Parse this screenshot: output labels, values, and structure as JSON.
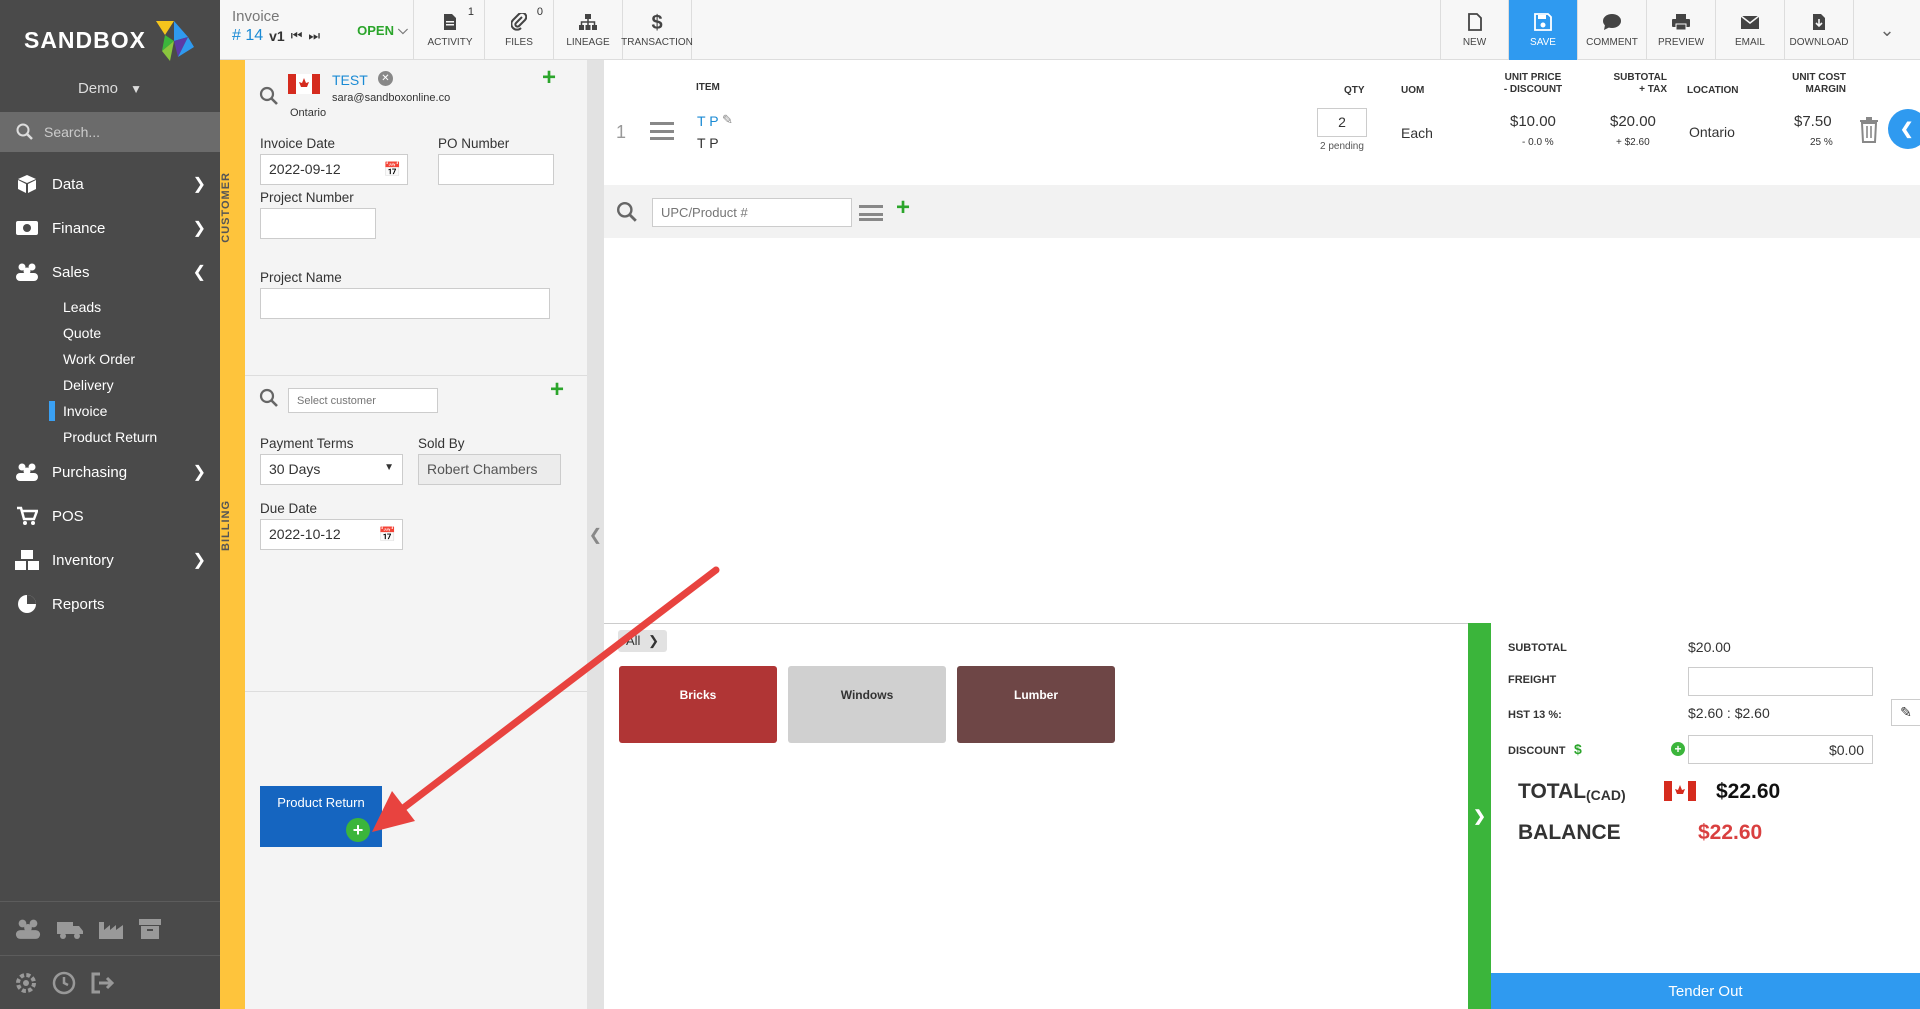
{
  "app": {
    "logo_text": "SANDBOX",
    "company": "Demo"
  },
  "sidebar": {
    "search_placeholder": "Search...",
    "items": [
      {
        "label": "Data",
        "icon": "cube-icon"
      },
      {
        "label": "Finance",
        "icon": "money-icon"
      },
      {
        "label": "Sales",
        "icon": "people-icon"
      },
      {
        "label": "Purchasing",
        "icon": "people-icon"
      },
      {
        "label": "POS",
        "icon": "cart-icon"
      },
      {
        "label": "Inventory",
        "icon": "boxes-icon"
      },
      {
        "label": "Reports",
        "icon": "pie-icon"
      }
    ],
    "sales_sub": [
      "Leads",
      "Quote",
      "Work Order",
      "Delivery",
      "Invoice",
      "Product Return"
    ]
  },
  "topbar": {
    "doc_type": "Invoice",
    "doc_number": "# 14",
    "version": "v1",
    "status": "OPEN",
    "buttons": {
      "activity": "ACTIVITY",
      "activity_count": "1",
      "files": "FILES",
      "files_count": "0",
      "lineage": "LINEAGE",
      "transaction": "TRANSACTION",
      "new": "NEW",
      "save": "SAVE",
      "comment": "COMMENT",
      "preview": "PREVIEW",
      "email": "EMAIL",
      "download": "DOWNLOAD"
    }
  },
  "customer": {
    "section_label": "CUSTOMER",
    "name": "TEST",
    "email": "sara@sandboxonline.co",
    "region": "Ontario",
    "invoice_date_label": "Invoice Date",
    "invoice_date": "2022-09-12",
    "po_label": "PO Number",
    "po_value": "",
    "project_number_label": "Project Number",
    "project_number": "",
    "project_name_label": "Project Name",
    "project_name": ""
  },
  "billing": {
    "section_label": "BILLING",
    "select_placeholder": "Select customer",
    "payment_terms_label": "Payment Terms",
    "payment_terms": "30 Days",
    "sold_by_label": "Sold By",
    "sold_by": "Robert Chambers",
    "due_date_label": "Due Date",
    "due_date": "2022-10-12"
  },
  "product_return_button": "Product Return",
  "line_headers": {
    "item": "ITEM",
    "qty": "QTY",
    "uom": "UOM",
    "unit_price": "UNIT PRICE",
    "unit_price_sub": "- DISCOUNT",
    "subtotal": "SUBTOTAL",
    "subtotal_sub": "+ TAX",
    "location": "LOCATION",
    "unit_cost": "UNIT COST",
    "unit_cost_sub": "MARGIN"
  },
  "line_items": [
    {
      "index": "1",
      "code": "T P",
      "description": "T P",
      "qty": "2",
      "pending": "2 pending",
      "uom": "Each",
      "unit_price": "$10.00",
      "discount": "- 0.0 %",
      "subtotal": "$20.00",
      "tax": "+ $2.60",
      "location": "Ontario",
      "unit_cost": "$7.50",
      "margin": "25 %"
    }
  ],
  "add_product": {
    "placeholder": "UPC/Product #"
  },
  "categories": {
    "breadcrumb": "All",
    "tiles": [
      {
        "label": "Bricks",
        "color": "#b03535"
      },
      {
        "label": "Windows",
        "color": "#d0d0d0"
      },
      {
        "label": "Lumber",
        "color": "#6e4646"
      }
    ]
  },
  "totals": {
    "subtotal_label": "SUBTOTAL",
    "subtotal": "$20.00",
    "freight_label": "FREIGHT",
    "freight": "",
    "hst_label": "HST 13 %:",
    "hst": "$2.60 : $2.60",
    "discount_label": "DISCOUNT",
    "discount_currency": "$",
    "discount": "$0.00",
    "total_label": "TOTAL",
    "total_currency": "(CAD)",
    "total": "$22.60",
    "balance_label": "BALANCE",
    "balance": "$22.60",
    "tender_label": "Tender Out"
  }
}
